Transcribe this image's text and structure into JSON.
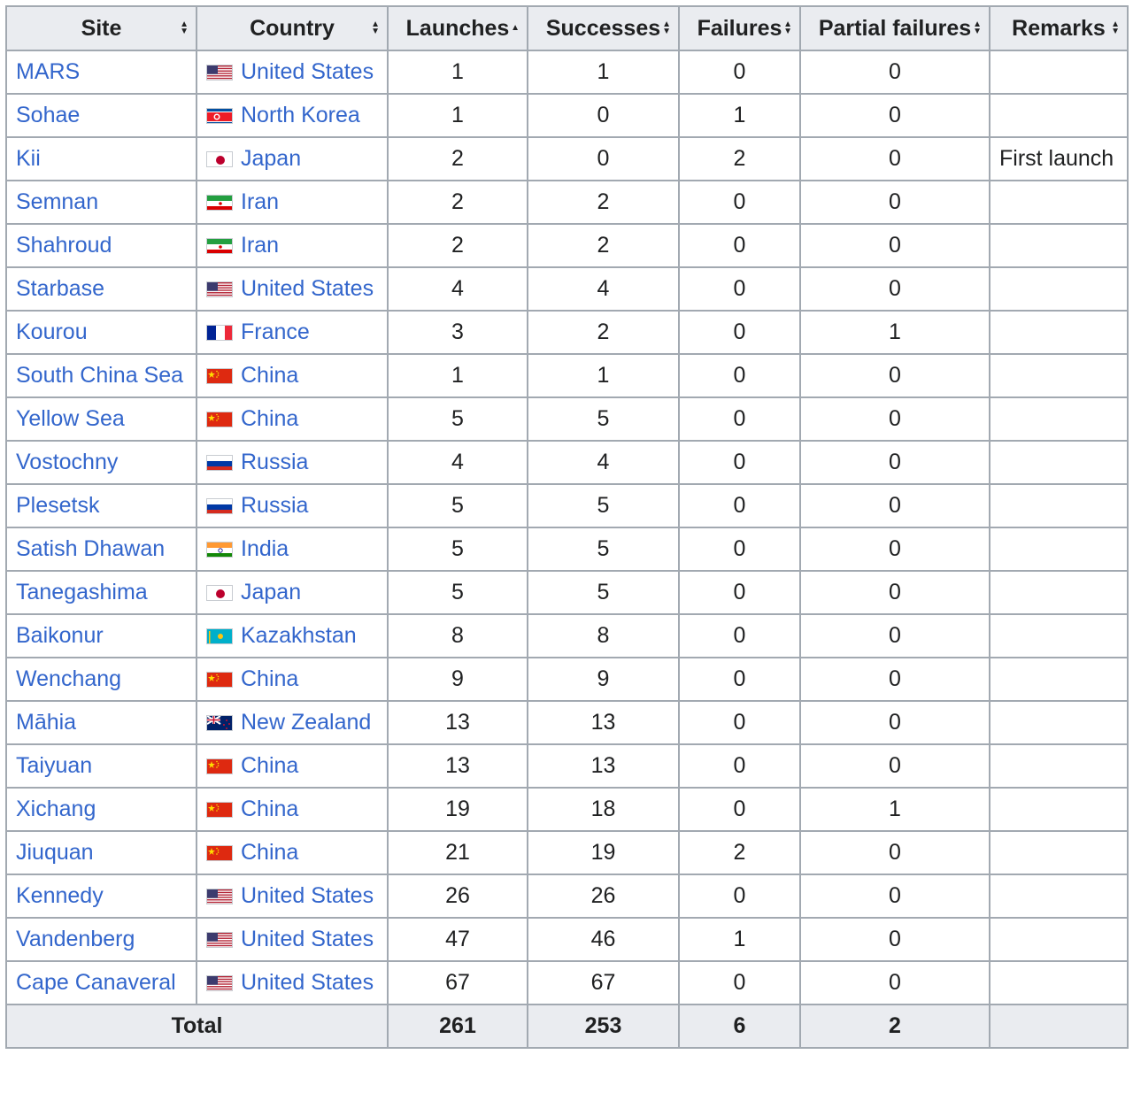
{
  "headers": {
    "site": "Site",
    "country": "Country",
    "launches": "Launches",
    "successes": "Successes",
    "failures": "Failures",
    "partial": "Partial failures",
    "remarks": "Remarks"
  },
  "colors": {
    "link": "#3366cc",
    "header_bg": "#eaecf0",
    "border": "#a2a9b1"
  },
  "rows": [
    {
      "site": "MARS",
      "flag": "us",
      "country": "United States",
      "launches": "1",
      "successes": "1",
      "failures": "0",
      "partial": "0",
      "remarks": ""
    },
    {
      "site": "Sohae",
      "flag": "kp",
      "country": "North Korea",
      "launches": "1",
      "successes": "0",
      "failures": "1",
      "partial": "0",
      "remarks": ""
    },
    {
      "site": "Kii",
      "flag": "jp",
      "country": "Japan",
      "launches": "2",
      "successes": "0",
      "failures": "2",
      "partial": "0",
      "remarks": "First launch"
    },
    {
      "site": "Semnan",
      "flag": "ir",
      "country": "Iran",
      "launches": "2",
      "successes": "2",
      "failures": "0",
      "partial": "0",
      "remarks": ""
    },
    {
      "site": "Shahroud",
      "flag": "ir",
      "country": "Iran",
      "launches": "2",
      "successes": "2",
      "failures": "0",
      "partial": "0",
      "remarks": ""
    },
    {
      "site": "Starbase",
      "flag": "us",
      "country": "United States",
      "launches": "4",
      "successes": "4",
      "failures": "0",
      "partial": "0",
      "remarks": ""
    },
    {
      "site": "Kourou",
      "flag": "fr",
      "country": "France",
      "launches": "3",
      "successes": "2",
      "failures": "0",
      "partial": "1",
      "remarks": ""
    },
    {
      "site": "South China Sea",
      "flag": "cn",
      "country": "China",
      "launches": "1",
      "successes": "1",
      "failures": "0",
      "partial": "0",
      "remarks": ""
    },
    {
      "site": "Yellow Sea",
      "flag": "cn",
      "country": "China",
      "launches": "5",
      "successes": "5",
      "failures": "0",
      "partial": "0",
      "remarks": ""
    },
    {
      "site": "Vostochny",
      "flag": "ru",
      "country": "Russia",
      "launches": "4",
      "successes": "4",
      "failures": "0",
      "partial": "0",
      "remarks": ""
    },
    {
      "site": "Plesetsk",
      "flag": "ru",
      "country": "Russia",
      "launches": "5",
      "successes": "5",
      "failures": "0",
      "partial": "0",
      "remarks": ""
    },
    {
      "site": "Satish Dhawan",
      "flag": "in",
      "country": "India",
      "launches": "5",
      "successes": "5",
      "failures": "0",
      "partial": "0",
      "remarks": ""
    },
    {
      "site": "Tanegashima",
      "flag": "jp",
      "country": "Japan",
      "launches": "5",
      "successes": "5",
      "failures": "0",
      "partial": "0",
      "remarks": ""
    },
    {
      "site": "Baikonur",
      "flag": "kz",
      "country": "Kazakhstan",
      "launches": "8",
      "successes": "8",
      "failures": "0",
      "partial": "0",
      "remarks": ""
    },
    {
      "site": "Wenchang",
      "flag": "cn",
      "country": "China",
      "launches": "9",
      "successes": "9",
      "failures": "0",
      "partial": "0",
      "remarks": ""
    },
    {
      "site": "Māhia",
      "flag": "nz",
      "country": "New Zealand",
      "launches": "13",
      "successes": "13",
      "failures": "0",
      "partial": "0",
      "remarks": ""
    },
    {
      "site": "Taiyuan",
      "flag": "cn",
      "country": "China",
      "launches": "13",
      "successes": "13",
      "failures": "0",
      "partial": "0",
      "remarks": ""
    },
    {
      "site": "Xichang",
      "flag": "cn",
      "country": "China",
      "launches": "19",
      "successes": "18",
      "failures": "0",
      "partial": "1",
      "remarks": ""
    },
    {
      "site": "Jiuquan",
      "flag": "cn",
      "country": "China",
      "launches": "21",
      "successes": "19",
      "failures": "2",
      "partial": "0",
      "remarks": ""
    },
    {
      "site": "Kennedy",
      "flag": "us",
      "country": "United States",
      "launches": "26",
      "successes": "26",
      "failures": "0",
      "partial": "0",
      "remarks": ""
    },
    {
      "site": "Vandenberg",
      "flag": "us",
      "country": "United States",
      "launches": "47",
      "successes": "46",
      "failures": "1",
      "partial": "0",
      "remarks": ""
    },
    {
      "site": "Cape Canaveral",
      "flag": "us",
      "country": "United States",
      "launches": "67",
      "successes": "67",
      "failures": "0",
      "partial": "0",
      "remarks": ""
    }
  ],
  "total": {
    "label": "Total",
    "launches": "261",
    "successes": "253",
    "failures": "6",
    "partial": "2"
  }
}
